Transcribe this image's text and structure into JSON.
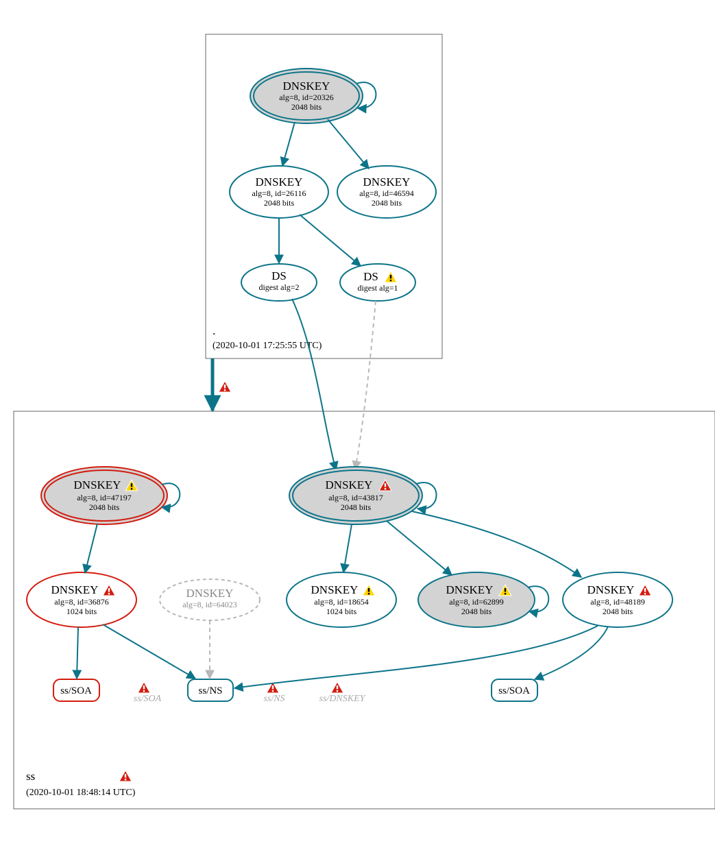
{
  "zones": {
    "root": {
      "label": ".",
      "timestamp": "(2020-10-01 17:25:55 UTC)"
    },
    "ss": {
      "label": "ss",
      "timestamp": "(2020-10-01 18:48:14 UTC)"
    }
  },
  "nodes": {
    "root_ksk": {
      "title": "DNSKEY",
      "line2": "alg=8, id=20326",
      "line3": "2048 bits"
    },
    "root_zsk1": {
      "title": "DNSKEY",
      "line2": "alg=8, id=26116",
      "line3": "2048 bits"
    },
    "root_zsk2": {
      "title": "DNSKEY",
      "line2": "alg=8, id=46594",
      "line3": "2048 bits"
    },
    "ds1": {
      "title": "DS",
      "line2": "digest alg=2"
    },
    "ds2": {
      "title": "DS",
      "line2": "digest alg=1",
      "warn": "yellow"
    },
    "ss_ksk1": {
      "title": "DNSKEY",
      "line2": "alg=8, id=47197",
      "line3": "2048 bits",
      "warn": "yellow"
    },
    "ss_ksk2": {
      "title": "DNSKEY",
      "line2": "alg=8, id=43817",
      "line3": "2048 bits",
      "warn": "red"
    },
    "ss_zsk1": {
      "title": "DNSKEY",
      "line2": "alg=8, id=36876",
      "line3": "1024 bits",
      "warn": "red"
    },
    "ss_ghost": {
      "title": "DNSKEY",
      "line2": "alg=8, id=64023"
    },
    "ss_zsk2": {
      "title": "DNSKEY",
      "line2": "alg=8, id=18654",
      "line3": "1024 bits",
      "warn": "yellow"
    },
    "ss_zsk3": {
      "title": "DNSKEY",
      "line2": "alg=8, id=62899",
      "line3": "2048 bits",
      "warn": "yellow"
    },
    "ss_zsk4": {
      "title": "DNSKEY",
      "line2": "alg=8, id=48189",
      "line3": "2048 bits",
      "warn": "red"
    },
    "soa1": {
      "title": "ss/SOA"
    },
    "ns1": {
      "title": "ss/NS"
    },
    "soa2": {
      "title": "ss/SOA"
    }
  },
  "ghosts": {
    "g_soa": "ss/SOA",
    "g_ns": "ss/NS",
    "g_dnskey": "ss/DNSKEY"
  }
}
